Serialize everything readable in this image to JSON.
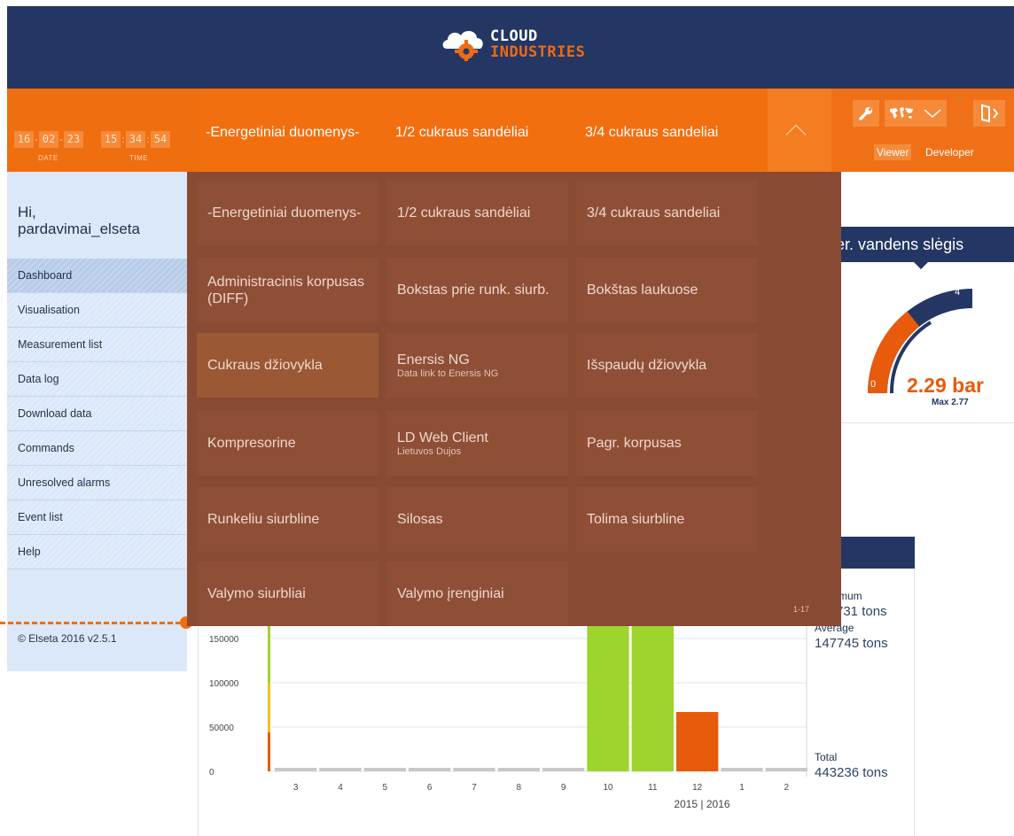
{
  "brand": {
    "line1": "CLOUD",
    "line2": "INDUSTRIES"
  },
  "datetime": {
    "date": [
      "16",
      "02",
      "23"
    ],
    "time": [
      "15",
      "34",
      "54"
    ],
    "date_label": "DATE",
    "time_label": "TIME"
  },
  "nav_tabs": [
    "-Energetiniai duomenys-",
    "1/2 cukraus sandėliai",
    "3/4 cukraus sandeliai"
  ],
  "roles": {
    "viewer": "Viewer",
    "developer": "Developer"
  },
  "user": {
    "greeting": "Hi,",
    "name": "pardavimai_elseta"
  },
  "sidebar_menu": [
    "Dashboard",
    "Visualisation",
    "Measurement list",
    "Data log",
    "Download data",
    "Commands",
    "Unresolved alarms",
    "Event list",
    "Help"
  ],
  "copyright": "© Elseta 2016 v2.5.1",
  "overlay_menu": {
    "items": [
      {
        "label": "-Energetiniai duomenys-",
        "sub": ""
      },
      {
        "label": "1/2 cukraus sandėliai",
        "sub": ""
      },
      {
        "label": "3/4 cukraus sandeliai",
        "sub": ""
      },
      {
        "label": "Administracinis korpusas (DIFF)",
        "sub": ""
      },
      {
        "label": "Bokstas prie runk. siurb.",
        "sub": ""
      },
      {
        "label": "Bokštas laukuose",
        "sub": ""
      },
      {
        "label": "Cukraus džiovykla",
        "sub": ""
      },
      {
        "label": "Enersis NG",
        "sub": "Data link to Enersis NG"
      },
      {
        "label": "Išspaudų džiovykla",
        "sub": ""
      },
      {
        "label": "Kompresorine",
        "sub": ""
      },
      {
        "label": "LD Web Client",
        "sub": "Lietuvos Dujos"
      },
      {
        "label": "Pagr. korpusas",
        "sub": ""
      },
      {
        "label": "Runkeliu siurbline",
        "sub": ""
      },
      {
        "label": "Silosas",
        "sub": ""
      },
      {
        "label": "Tolima siurbline",
        "sub": ""
      },
      {
        "label": "Valymo siurbliai",
        "sub": ""
      },
      {
        "label": "Valymo įrenginiai",
        "sub": ""
      }
    ],
    "page_indicator": "1-17"
  },
  "gauge": {
    "title": "er. vandens slėgis",
    "value_text": "2.29 bar",
    "max_text": "Max 2.77",
    "min_label": "0",
    "max_label": "4",
    "value": 2.29,
    "max_value": 4
  },
  "stats": {
    "max_label": "mum",
    "max_value": "731 tons",
    "avg_label": "Average",
    "avg_value": "147745 tons",
    "total_label": "Total",
    "total_value": "443236 tons"
  },
  "chart_data": {
    "type": "bar",
    "categories": [
      "3",
      "4",
      "5",
      "6",
      "7",
      "8",
      "9",
      "10",
      "11",
      "12",
      "1",
      "2"
    ],
    "values": [
      0,
      0,
      0,
      0,
      0,
      0,
      0,
      172000,
      200000,
      67000,
      0,
      0
    ],
    "bar_colors": [
      "#c8c8c8",
      "#c8c8c8",
      "#c8c8c8",
      "#c8c8c8",
      "#c8c8c8",
      "#c8c8c8",
      "#c8c8c8",
      "#9dd42e",
      "#9dd42e",
      "#e85a0c",
      "#c8c8c8",
      "#c8c8c8"
    ],
    "y_ticks": [
      0,
      50000,
      100000,
      150000
    ],
    "ylim": [
      0,
      200000
    ],
    "x_caption": "2015 | 2016"
  },
  "colors": {
    "navy": "#243764",
    "orange": "#f07017",
    "overlay": "#894a33",
    "sidebar": "#dbe8fa"
  }
}
